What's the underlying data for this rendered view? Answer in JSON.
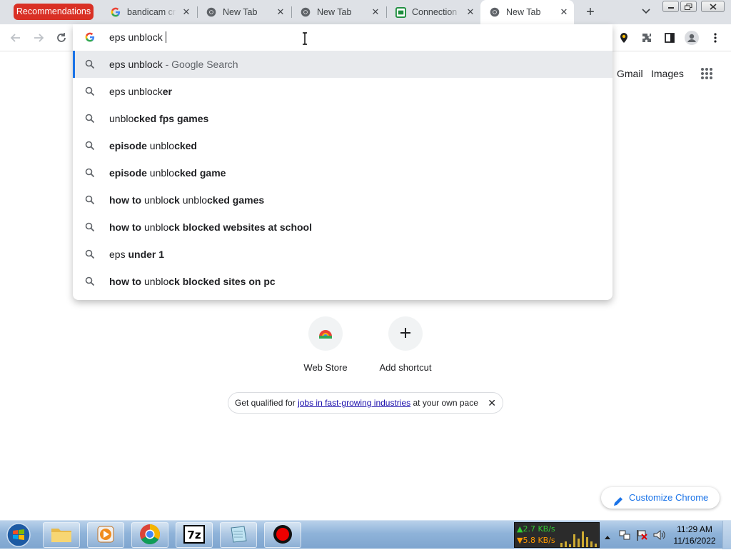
{
  "browser": {
    "tabs": [
      {
        "label": "Recommendations",
        "kind": "group-chip",
        "color": "#d93025"
      },
      {
        "label": "bandicam crack",
        "icon": "google-icon"
      },
      {
        "label": "New Tab",
        "icon": "chrome-icon"
      },
      {
        "label": "New Tab",
        "icon": "chrome-icon"
      },
      {
        "label": "Connection ...",
        "icon": "connection-icon"
      },
      {
        "label": "New Tab",
        "icon": "chrome-icon",
        "active": true
      }
    ],
    "new_tab_glyph": "+"
  },
  "omnibox": {
    "query": "eps unblock",
    "suggestions": [
      {
        "parts": [
          {
            "t": "eps unblock",
            "b": false
          },
          {
            "t": " - Google Search",
            "b": false,
            "dim": true
          }
        ],
        "selected": true
      },
      {
        "parts": [
          {
            "t": "eps unblock",
            "b": false
          },
          {
            "t": "er",
            "b": true
          }
        ]
      },
      {
        "parts": [
          {
            "t": "unblo",
            "b": false
          },
          {
            "t": "cked fps games",
            "b": true
          }
        ]
      },
      {
        "parts": [
          {
            "t": "episode",
            "b": true
          },
          {
            "t": " unblo",
            "b": false
          },
          {
            "t": "cked",
            "b": true
          }
        ]
      },
      {
        "parts": [
          {
            "t": "episode",
            "b": true
          },
          {
            "t": " unblo",
            "b": false
          },
          {
            "t": "cked game",
            "b": true
          }
        ]
      },
      {
        "parts": [
          {
            "t": "how to",
            "b": true
          },
          {
            "t": " unblo",
            "b": false
          },
          {
            "t": "ck",
            "b": true
          },
          {
            "t": " unblo",
            "b": false
          },
          {
            "t": "cked games",
            "b": true
          }
        ]
      },
      {
        "parts": [
          {
            "t": "how to",
            "b": true
          },
          {
            "t": " unblo",
            "b": false
          },
          {
            "t": "ck blocked websites at school",
            "b": true
          }
        ]
      },
      {
        "parts": [
          {
            "t": "eps ",
            "b": false
          },
          {
            "t": "under 1",
            "b": true
          }
        ]
      },
      {
        "parts": [
          {
            "t": "how to",
            "b": true
          },
          {
            "t": " unblo",
            "b": false
          },
          {
            "t": "ck blocked sites on pc",
            "b": true
          }
        ]
      }
    ]
  },
  "page": {
    "header_links": {
      "gmail": "Gmail",
      "images": "Images"
    },
    "shortcuts": [
      {
        "label": "Web Store",
        "icon": "web-store-icon"
      },
      {
        "label": "Add shortcut",
        "icon": "plus-icon"
      }
    ],
    "promo": {
      "prefix": "Get qualified for ",
      "link": "jobs in fast-growing industries",
      "suffix": " at your own pace",
      "close": "✕"
    },
    "customize_label": "Customize Chrome"
  },
  "taskbar": {
    "apps": [
      "explorer-icon",
      "media-player-icon",
      "chrome-icon",
      "7zip-icon",
      "notepad-icon",
      "bandicam-record-icon"
    ],
    "net_up": "▲2.7 KB/s",
    "net_down": "▼5.8 KB/s",
    "time": "11:29 AM",
    "date": "11/16/2022"
  }
}
